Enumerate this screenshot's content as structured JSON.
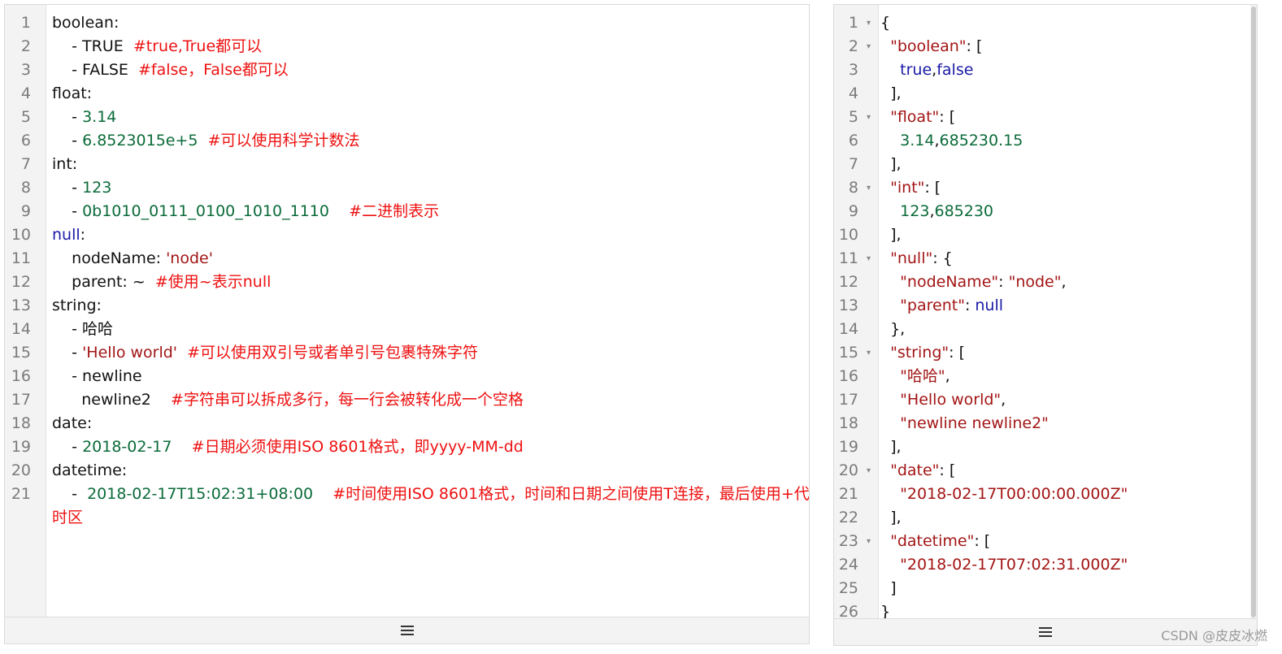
{
  "left_editor": {
    "lines": [
      {
        "n": "1",
        "tokens": [
          {
            "t": "boolean:",
            "c": "key"
          }
        ]
      },
      {
        "n": "2",
        "tokens": [
          {
            "t": "    - TRUE  ",
            "c": "txt"
          },
          {
            "t": "#true,True都可以",
            "c": "cmt"
          }
        ]
      },
      {
        "n": "3",
        "tokens": [
          {
            "t": "    - FALSE  ",
            "c": "txt"
          },
          {
            "t": "#false，False都可以",
            "c": "cmt"
          }
        ]
      },
      {
        "n": "4",
        "tokens": [
          {
            "t": "float:",
            "c": "key"
          }
        ]
      },
      {
        "n": "5",
        "tokens": [
          {
            "t": "    - ",
            "c": "txt"
          },
          {
            "t": "3.14",
            "c": "num"
          }
        ]
      },
      {
        "n": "6",
        "tokens": [
          {
            "t": "    - ",
            "c": "txt"
          },
          {
            "t": "6.8523015e+5",
            "c": "num"
          },
          {
            "t": "  #可以使用科学计数法",
            "c": "cmt"
          }
        ]
      },
      {
        "n": "7",
        "tokens": [
          {
            "t": "int:",
            "c": "key"
          }
        ]
      },
      {
        "n": "8",
        "tokens": [
          {
            "t": "    - ",
            "c": "txt"
          },
          {
            "t": "123",
            "c": "num"
          }
        ]
      },
      {
        "n": "9",
        "tokens": [
          {
            "t": "    - ",
            "c": "txt"
          },
          {
            "t": "0b1010_0111_0100_1010_1110",
            "c": "num"
          },
          {
            "t": "    #二进制表示",
            "c": "cmt"
          }
        ]
      },
      {
        "n": "10",
        "tokens": [
          {
            "t": "null",
            "c": "kw"
          },
          {
            "t": ":",
            "c": "txt"
          }
        ]
      },
      {
        "n": "11",
        "tokens": [
          {
            "t": "    nodeName: ",
            "c": "txt"
          },
          {
            "t": "'node'",
            "c": "str"
          }
        ]
      },
      {
        "n": "12",
        "tokens": [
          {
            "t": "    parent: ~  ",
            "c": "txt"
          },
          {
            "t": "#使用~表示null",
            "c": "cmt"
          }
        ]
      },
      {
        "n": "13",
        "tokens": [
          {
            "t": "string:",
            "c": "key"
          }
        ]
      },
      {
        "n": "14",
        "tokens": [
          {
            "t": "    - 哈哈",
            "c": "txt"
          }
        ]
      },
      {
        "n": "15",
        "tokens": [
          {
            "t": "    - ",
            "c": "txt"
          },
          {
            "t": "'Hello world'",
            "c": "str"
          },
          {
            "t": "  #可以使用双引号或者单引号包裹特殊字符",
            "c": "cmt"
          }
        ]
      },
      {
        "n": "16",
        "tokens": [
          {
            "t": "    - newline",
            "c": "txt"
          }
        ]
      },
      {
        "n": "17",
        "tokens": [
          {
            "t": "      newline2    ",
            "c": "txt"
          },
          {
            "t": "#字符串可以拆成多行，每一行会被转化成一个空格",
            "c": "cmt"
          }
        ]
      },
      {
        "n": "18",
        "tokens": [
          {
            "t": "date:",
            "c": "key"
          }
        ]
      },
      {
        "n": "19",
        "tokens": [
          {
            "t": "    - ",
            "c": "txt"
          },
          {
            "t": "2018-02-17",
            "c": "num"
          },
          {
            "t": "    #日期必须使用ISO 8601格式，即yyyy-MM-dd",
            "c": "cmt"
          }
        ]
      },
      {
        "n": "20",
        "tokens": [
          {
            "t": "datetime:",
            "c": "key"
          }
        ]
      },
      {
        "n": "21",
        "tokens": [
          {
            "t": "    -  ",
            "c": "txt"
          },
          {
            "t": "2018-02-17T15:02:31+08:00",
            "c": "num"
          },
          {
            "t": "    #时间使用ISO 8601格式，时间和日期之间使用T连接，最后使用+代表",
            "c": "cmt"
          }
        ]
      },
      {
        "n": "",
        "tokens": [
          {
            "t": "时区",
            "c": "cmt"
          }
        ]
      }
    ]
  },
  "right_editor": {
    "lines": [
      {
        "n": "1",
        "fold": true,
        "tokens": [
          {
            "t": "{",
            "c": "txt"
          }
        ]
      },
      {
        "n": "2",
        "fold": true,
        "tokens": [
          {
            "t": "  ",
            "c": "txt"
          },
          {
            "t": "\"boolean\"",
            "c": "str"
          },
          {
            "t": ": [",
            "c": "txt"
          }
        ]
      },
      {
        "n": "3",
        "fold": false,
        "tokens": [
          {
            "t": "    ",
            "c": "txt"
          },
          {
            "t": "true",
            "c": "kw"
          },
          {
            "t": ",",
            "c": "txt"
          },
          {
            "t": "false",
            "c": "kw"
          }
        ]
      },
      {
        "n": "4",
        "fold": false,
        "tokens": [
          {
            "t": "  ],",
            "c": "txt"
          }
        ]
      },
      {
        "n": "5",
        "fold": true,
        "tokens": [
          {
            "t": "  ",
            "c": "txt"
          },
          {
            "t": "\"float\"",
            "c": "str"
          },
          {
            "t": ": [",
            "c": "txt"
          }
        ]
      },
      {
        "n": "6",
        "fold": false,
        "tokens": [
          {
            "t": "    ",
            "c": "txt"
          },
          {
            "t": "3.14",
            "c": "num"
          },
          {
            "t": ",",
            "c": "txt"
          },
          {
            "t": "685230.15",
            "c": "num"
          }
        ]
      },
      {
        "n": "7",
        "fold": false,
        "tokens": [
          {
            "t": "  ],",
            "c": "txt"
          }
        ]
      },
      {
        "n": "8",
        "fold": true,
        "tokens": [
          {
            "t": "  ",
            "c": "txt"
          },
          {
            "t": "\"int\"",
            "c": "str"
          },
          {
            "t": ": [",
            "c": "txt"
          }
        ]
      },
      {
        "n": "9",
        "fold": false,
        "tokens": [
          {
            "t": "    ",
            "c": "txt"
          },
          {
            "t": "123",
            "c": "num"
          },
          {
            "t": ",",
            "c": "txt"
          },
          {
            "t": "685230",
            "c": "num"
          }
        ]
      },
      {
        "n": "10",
        "fold": false,
        "tokens": [
          {
            "t": "  ],",
            "c": "txt"
          }
        ]
      },
      {
        "n": "11",
        "fold": true,
        "tokens": [
          {
            "t": "  ",
            "c": "txt"
          },
          {
            "t": "\"null\"",
            "c": "str"
          },
          {
            "t": ": {",
            "c": "txt"
          }
        ]
      },
      {
        "n": "12",
        "fold": false,
        "tokens": [
          {
            "t": "    ",
            "c": "txt"
          },
          {
            "t": "\"nodeName\"",
            "c": "str"
          },
          {
            "t": ": ",
            "c": "txt"
          },
          {
            "t": "\"node\"",
            "c": "str"
          },
          {
            "t": ",",
            "c": "txt"
          }
        ]
      },
      {
        "n": "13",
        "fold": false,
        "tokens": [
          {
            "t": "    ",
            "c": "txt"
          },
          {
            "t": "\"parent\"",
            "c": "str"
          },
          {
            "t": ": ",
            "c": "txt"
          },
          {
            "t": "null",
            "c": "kw"
          }
        ]
      },
      {
        "n": "14",
        "fold": false,
        "tokens": [
          {
            "t": "  },",
            "c": "txt"
          }
        ]
      },
      {
        "n": "15",
        "fold": true,
        "tokens": [
          {
            "t": "  ",
            "c": "txt"
          },
          {
            "t": "\"string\"",
            "c": "str"
          },
          {
            "t": ": [",
            "c": "txt"
          }
        ]
      },
      {
        "n": "16",
        "fold": false,
        "tokens": [
          {
            "t": "    ",
            "c": "txt"
          },
          {
            "t": "\"哈哈\"",
            "c": "str"
          },
          {
            "t": ",",
            "c": "txt"
          }
        ]
      },
      {
        "n": "17",
        "fold": false,
        "tokens": [
          {
            "t": "    ",
            "c": "txt"
          },
          {
            "t": "\"Hello world\"",
            "c": "str"
          },
          {
            "t": ",",
            "c": "txt"
          }
        ]
      },
      {
        "n": "18",
        "fold": false,
        "tokens": [
          {
            "t": "    ",
            "c": "txt"
          },
          {
            "t": "\"newline newline2\"",
            "c": "str"
          }
        ]
      },
      {
        "n": "19",
        "fold": false,
        "tokens": [
          {
            "t": "  ],",
            "c": "txt"
          }
        ]
      },
      {
        "n": "20",
        "fold": true,
        "tokens": [
          {
            "t": "  ",
            "c": "txt"
          },
          {
            "t": "\"date\"",
            "c": "str"
          },
          {
            "t": ": [",
            "c": "txt"
          }
        ]
      },
      {
        "n": "21",
        "fold": false,
        "tokens": [
          {
            "t": "    ",
            "c": "txt"
          },
          {
            "t": "\"2018-02-17T00:00:00.000Z\"",
            "c": "str"
          }
        ]
      },
      {
        "n": "22",
        "fold": false,
        "tokens": [
          {
            "t": "  ],",
            "c": "txt"
          }
        ]
      },
      {
        "n": "23",
        "fold": true,
        "tokens": [
          {
            "t": "  ",
            "c": "txt"
          },
          {
            "t": "\"datetime\"",
            "c": "str"
          },
          {
            "t": ": [",
            "c": "txt"
          }
        ]
      },
      {
        "n": "24",
        "fold": false,
        "tokens": [
          {
            "t": "    ",
            "c": "txt"
          },
          {
            "t": "\"2018-02-17T07:02:31.000Z\"",
            "c": "str"
          }
        ]
      },
      {
        "n": "25",
        "fold": false,
        "tokens": [
          {
            "t": "  ]",
            "c": "txt"
          }
        ]
      },
      {
        "n": "26",
        "fold": false,
        "tokens": [
          {
            "t": "}",
            "c": "txt"
          }
        ]
      }
    ]
  },
  "icons": {
    "resize": "resize-handle-icon",
    "fold": "fold-arrow-icon",
    "fold_glyph": "▾"
  },
  "watermark": "CSDN @皮皮冰燃",
  "colors": {
    "string": "#a31515",
    "number": "#0b6b3a",
    "keyword": "#1a1aa6",
    "comment": "#ee1111",
    "text": "#111111"
  }
}
